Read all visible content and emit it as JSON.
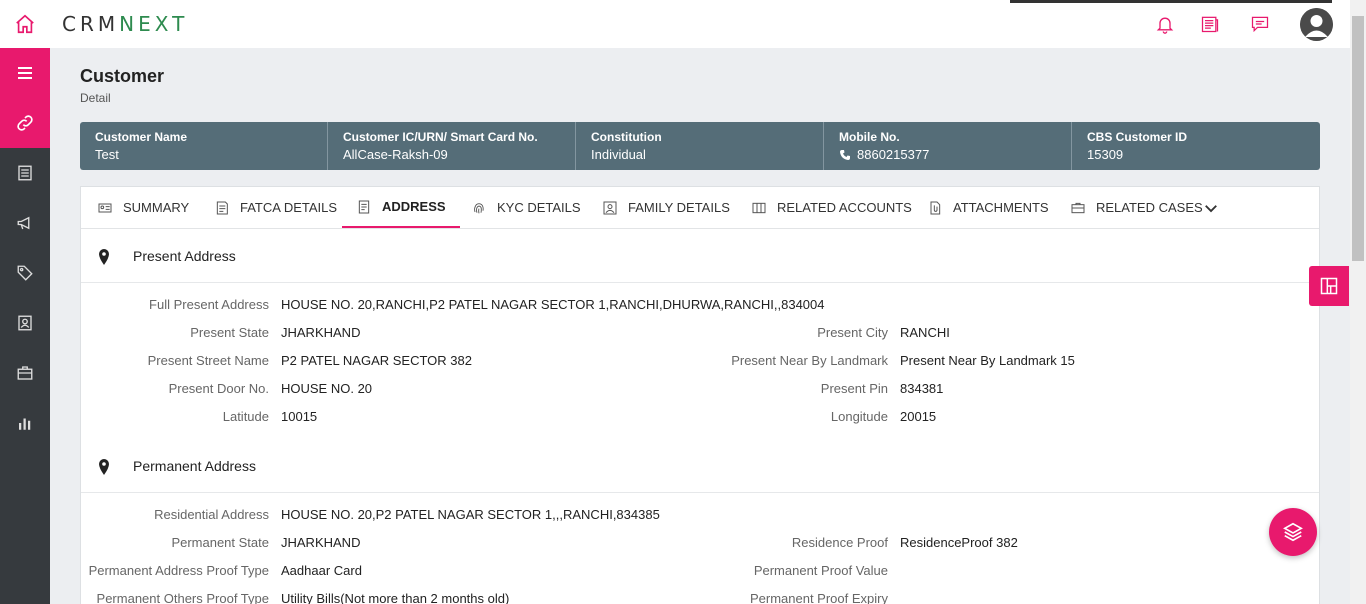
{
  "app": {
    "logo_text_left": "CRM",
    "logo_text_right": "NEXT",
    "accent_color": "#e8196d",
    "nav_color": "#363a3e"
  },
  "header_icons": [
    "bell-icon",
    "notes-icon",
    "chat-icon",
    "user-avatar"
  ],
  "sidenav": {
    "items": [
      "menu-icon",
      "link-icon",
      "document-icon",
      "megaphone-icon",
      "tag-icon",
      "contact-card-icon",
      "briefcase-icon",
      "bar-chart-icon"
    ]
  },
  "page": {
    "title": "Customer",
    "subtitle": "Detail"
  },
  "summary": {
    "cells": [
      {
        "label": "Customer Name",
        "value": "Test"
      },
      {
        "label": "Customer IC/URN/ Smart Card No.",
        "value": "AllCase-Raksh-09"
      },
      {
        "label": "Constitution",
        "value": "Individual"
      },
      {
        "label": "Mobile No.",
        "value": "8860215377"
      },
      {
        "label": "CBS Customer ID",
        "value": "15309"
      }
    ]
  },
  "tabs": [
    {
      "label": "SUMMARY"
    },
    {
      "label": "FATCA DETAILS"
    },
    {
      "label": "ADDRESS"
    },
    {
      "label": "KYC DETAILS"
    },
    {
      "label": "FAMILY DETAILS"
    },
    {
      "label": "RELATED ACCOUNTS"
    },
    {
      "label": "ATTACHMENTS"
    },
    {
      "label": "RELATED CASES"
    }
  ],
  "active_tab": "ADDRESS",
  "present": {
    "title": "Present Address",
    "full_label": "Full Present Address",
    "full_value": "HOUSE NO. 20,RANCHI,P2 PATEL NAGAR SECTOR 1,RANCHI,DHURWA,RANCHI,,834004",
    "state_label": "Present State",
    "state_value": "JHARKHAND",
    "city_label": "Present City",
    "city_value": "RANCHI",
    "street_label": "Present Street Name",
    "street_value": "P2 PATEL NAGAR SECTOR 382",
    "landmark_label": "Present Near By Landmark",
    "landmark_value": "Present Near By Landmark 15",
    "door_label": "Present Door No.",
    "door_value": "HOUSE NO. 20",
    "pin_label": "Present Pin",
    "pin_value": "834381",
    "lat_label": "Latitude",
    "lat_value": "10015",
    "long_label": "Longitude",
    "long_value": "20015"
  },
  "permanent": {
    "title": "Permanent Address",
    "res_label": "Residential Address",
    "res_value": "HOUSE NO. 20,P2 PATEL NAGAR SECTOR 1,,,RANCHI,834385",
    "state_label": "Permanent State",
    "state_value": "JHARKHAND",
    "proof_label": "Residence Proof",
    "proof_value": "ResidenceProof 382",
    "ptype_label": "Permanent Address Proof Type",
    "ptype_value": "Aadhaar Card",
    "pvalue_label": "Permanent Proof Value",
    "pvalue_value": "",
    "others_label": "Permanent Others Proof Type",
    "others_value": "Utility Bills(Not more than 2 months old)",
    "expiry_label": "Permanent Proof Expiry",
    "expiry_value": ""
  }
}
